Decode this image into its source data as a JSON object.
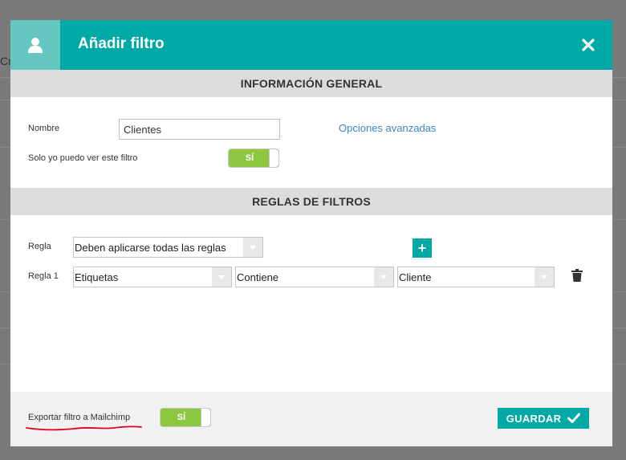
{
  "background": {
    "partial_text": "Cr"
  },
  "dialog": {
    "title": "Añadir filtro",
    "header_icon": "user-icon",
    "close_icon": "close-icon"
  },
  "general_section": {
    "title": "INFORMACIÓN GENERAL",
    "name_label": "Nombre",
    "name_value": "Clientes",
    "advanced_options_link": "Opciones avanzadas",
    "private_label": "Solo yo puedo ver este filtro",
    "private_toggle": "SÍ"
  },
  "rules_section": {
    "title": "REGLAS DE FILTROS",
    "rule_label": "Regla",
    "rule_mode": "Deben aplicarse todas las reglas",
    "add_rule_label": "+",
    "rule1_label": "Regla 1",
    "rule1_field": "Etiquetas",
    "rule1_operator": "Contiene",
    "rule1_value": "Cliente",
    "delete_icon": "trash-icon"
  },
  "footer": {
    "export_label": "Exportar filtro a Mailchimp",
    "export_toggle": "SÍ",
    "save_label": "GUARDAR"
  },
  "colors": {
    "accent": "#00a9a5",
    "toggle_on": "#8dc63f",
    "link": "#3b87c4",
    "annotation": "#e0001a"
  }
}
